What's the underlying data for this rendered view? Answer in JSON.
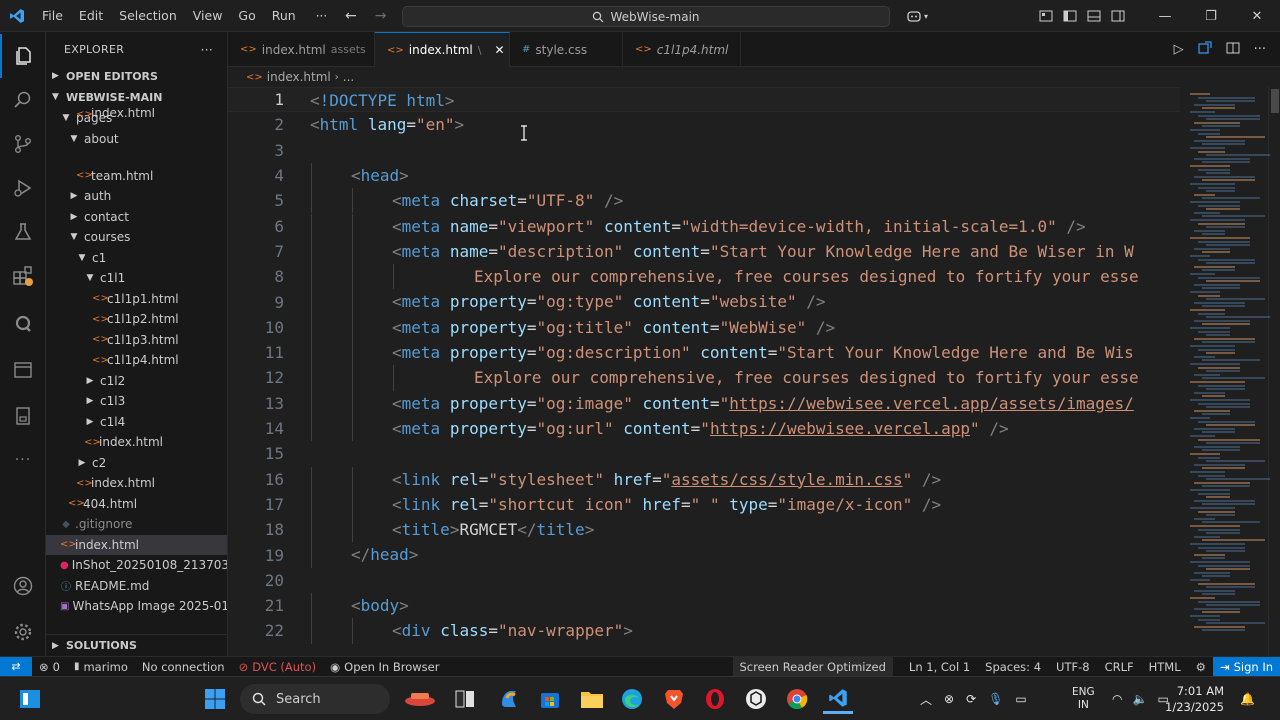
{
  "menu": [
    "File",
    "Edit",
    "Selection",
    "View",
    "Go",
    "Run"
  ],
  "menu_more": "···",
  "command_center": "WebWise-main",
  "explorer": {
    "header": "EXPLORER",
    "more": "···",
    "open_editors": "OPEN EDITORS",
    "root": "WEBWISE-MAIN",
    "solutions": "SOLUTIONS",
    "tree": [
      {
        "label": "pages",
        "depth": 1,
        "kind": "folder-open"
      },
      {
        "label": "about",
        "depth": 2,
        "kind": "folder-open"
      },
      {
        "label": "index.html",
        "depth": 3,
        "kind": "file",
        "partial": true
      },
      {
        "label": "team.html",
        "depth": 3,
        "kind": "file"
      },
      {
        "label": "auth",
        "depth": 2,
        "kind": "folder"
      },
      {
        "label": "contact",
        "depth": 2,
        "kind": "folder"
      },
      {
        "label": "courses",
        "depth": 2,
        "kind": "folder-open"
      },
      {
        "label": "c1",
        "depth": 3,
        "kind": "folder-open"
      },
      {
        "label": "c1l1",
        "depth": 4,
        "kind": "folder-open"
      },
      {
        "label": "c1l1p1.html",
        "depth": 5,
        "kind": "file"
      },
      {
        "label": "c1l1p2.html",
        "depth": 5,
        "kind": "file"
      },
      {
        "label": "c1l1p3.html",
        "depth": 5,
        "kind": "file"
      },
      {
        "label": "c1l1p4.html",
        "depth": 5,
        "kind": "file"
      },
      {
        "label": "c1l2",
        "depth": 4,
        "kind": "folder"
      },
      {
        "label": "c1l3",
        "depth": 4,
        "kind": "folder"
      },
      {
        "label": "c1l4",
        "depth": 4,
        "kind": "folder"
      },
      {
        "label": "index.html",
        "depth": 4,
        "kind": "file"
      },
      {
        "label": "c2",
        "depth": 3,
        "kind": "folder"
      },
      {
        "label": "index.html",
        "depth": 3,
        "kind": "file"
      },
      {
        "label": "404.html",
        "depth": 2,
        "kind": "file"
      },
      {
        "label": ".gitignore",
        "depth": 1,
        "kind": "git"
      },
      {
        "label": "index.html",
        "depth": 1,
        "kind": "file",
        "selected": true
      },
      {
        "label": "InShot_20250108_213703...",
        "depth": 1,
        "kind": "video"
      },
      {
        "label": "README.md",
        "depth": 1,
        "kind": "md"
      },
      {
        "label": "WhatsApp Image 2025-01...",
        "depth": 1,
        "kind": "image"
      }
    ]
  },
  "tabs": [
    {
      "label": "index.html",
      "desc": "assets",
      "active": false,
      "kind": "html"
    },
    {
      "label": "index.html",
      "desc": "\\",
      "active": true,
      "kind": "html"
    },
    {
      "label": "style.css",
      "desc": "",
      "active": false,
      "kind": "css"
    },
    {
      "label": "c1l1p4.html",
      "desc": "",
      "active": false,
      "kind": "html",
      "italic": true
    }
  ],
  "breadcrumbs": {
    "file": "index.html",
    "more": "..."
  },
  "code_lines": [
    {
      "n": "1",
      "indent": 0,
      "tokens": [
        [
          "punc",
          "<"
        ],
        [
          "tag",
          "!DOCTYPE"
        ],
        [
          "text",
          " "
        ],
        [
          "tag",
          "html"
        ],
        [
          "punc",
          ">"
        ]
      ]
    },
    {
      "n": "2",
      "indent": 0,
      "tokens": [
        [
          "punc",
          "<"
        ],
        [
          "tag",
          "html"
        ],
        [
          "text",
          " "
        ],
        [
          "attr",
          "lang"
        ],
        [
          "text",
          "="
        ],
        [
          "str",
          "\"en\""
        ],
        [
          "punc",
          ">"
        ]
      ]
    },
    {
      "n": "3",
      "indent": 0,
      "tokens": []
    },
    {
      "n": "4",
      "indent": 1,
      "tokens": [
        [
          "punc",
          "<"
        ],
        [
          "tag",
          "head"
        ],
        [
          "punc",
          ">"
        ]
      ]
    },
    {
      "n": "5",
      "indent": 2,
      "tokens": [
        [
          "punc",
          "<"
        ],
        [
          "tag",
          "meta"
        ],
        [
          "text",
          " "
        ],
        [
          "attr",
          "charset"
        ],
        [
          "text",
          "="
        ],
        [
          "str",
          "\"UTF-8\""
        ],
        [
          "text",
          " "
        ],
        [
          "punc",
          "/>"
        ]
      ]
    },
    {
      "n": "6",
      "indent": 2,
      "tokens": [
        [
          "punc",
          "<"
        ],
        [
          "tag",
          "meta"
        ],
        [
          "text",
          " "
        ],
        [
          "attr",
          "name"
        ],
        [
          "text",
          "="
        ],
        [
          "str",
          "\"viewport\""
        ],
        [
          "text",
          " "
        ],
        [
          "attr",
          "content"
        ],
        [
          "text",
          "="
        ],
        [
          "str",
          "\"width=device-width, initial-scale=1.0\""
        ],
        [
          "text",
          " "
        ],
        [
          "punc",
          "/>"
        ]
      ]
    },
    {
      "n": "7",
      "indent": 2,
      "tokens": [
        [
          "punc",
          "<"
        ],
        [
          "tag",
          "meta"
        ],
        [
          "text",
          " "
        ],
        [
          "attr",
          "name"
        ],
        [
          "text",
          "="
        ],
        [
          "str",
          "\"description\""
        ],
        [
          "text",
          " "
        ],
        [
          "attr",
          "content"
        ],
        [
          "text",
          "="
        ],
        [
          "str",
          "\"Start Your Knowledge Here and Be Wiser in W"
        ]
      ]
    },
    {
      "n": "8",
      "indent": 4,
      "tokens": [
        [
          "str",
          "Explore our comprehensive, free courses designed to fortify your esse"
        ]
      ]
    },
    {
      "n": "9",
      "indent": 2,
      "tokens": [
        [
          "punc",
          "<"
        ],
        [
          "tag",
          "meta"
        ],
        [
          "text",
          " "
        ],
        [
          "attr",
          "property"
        ],
        [
          "text",
          "="
        ],
        [
          "str",
          "\"og:type\""
        ],
        [
          "text",
          " "
        ],
        [
          "attr",
          "content"
        ],
        [
          "text",
          "="
        ],
        [
          "str",
          "\"website\""
        ],
        [
          "text",
          " "
        ],
        [
          "punc",
          "/>"
        ]
      ]
    },
    {
      "n": "10",
      "indent": 2,
      "tokens": [
        [
          "punc",
          "<"
        ],
        [
          "tag",
          "meta"
        ],
        [
          "text",
          " "
        ],
        [
          "attr",
          "property"
        ],
        [
          "text",
          "="
        ],
        [
          "str",
          "\"og:title\""
        ],
        [
          "text",
          " "
        ],
        [
          "attr",
          "content"
        ],
        [
          "text",
          "="
        ],
        [
          "str",
          "\"WebWise\""
        ],
        [
          "text",
          " "
        ],
        [
          "punc",
          "/>"
        ]
      ]
    },
    {
      "n": "11",
      "indent": 2,
      "tokens": [
        [
          "punc",
          "<"
        ],
        [
          "tag",
          "meta"
        ],
        [
          "text",
          " "
        ],
        [
          "attr",
          "property"
        ],
        [
          "text",
          "="
        ],
        [
          "str",
          "\"og:description\""
        ],
        [
          "text",
          " "
        ],
        [
          "attr",
          "content"
        ],
        [
          "text",
          "="
        ],
        [
          "str",
          "\"Start Your Knowledge Here and Be Wis"
        ]
      ]
    },
    {
      "n": "12",
      "indent": 4,
      "tokens": [
        [
          "str",
          "Explore our comprehensive, free courses designed to fortify your esse"
        ]
      ]
    },
    {
      "n": "13",
      "indent": 2,
      "tokens": [
        [
          "punc",
          "<"
        ],
        [
          "tag",
          "meta"
        ],
        [
          "text",
          " "
        ],
        [
          "attr",
          "property"
        ],
        [
          "text",
          "="
        ],
        [
          "str",
          "\"og:image\""
        ],
        [
          "text",
          " "
        ],
        [
          "attr",
          "content"
        ],
        [
          "text",
          "="
        ],
        [
          "str",
          "\""
        ],
        [
          "link",
          "https://webwisee.vercel.app/assets/images/"
        ]
      ]
    },
    {
      "n": "14",
      "indent": 2,
      "tokens": [
        [
          "punc",
          "<"
        ],
        [
          "tag",
          "meta"
        ],
        [
          "text",
          " "
        ],
        [
          "attr",
          "property"
        ],
        [
          "text",
          "="
        ],
        [
          "str",
          "\"og:url\""
        ],
        [
          "text",
          " "
        ],
        [
          "attr",
          "content"
        ],
        [
          "text",
          "="
        ],
        [
          "str",
          "\""
        ],
        [
          "link",
          "https://webwisee.vercel.app"
        ],
        [
          "str",
          "\""
        ],
        [
          "text",
          " "
        ],
        [
          "punc",
          "/>"
        ]
      ]
    },
    {
      "n": "15",
      "indent": 0,
      "tokens": []
    },
    {
      "n": "16",
      "indent": 2,
      "tokens": [
        [
          "punc",
          "<"
        ],
        [
          "tag",
          "link"
        ],
        [
          "text",
          " "
        ],
        [
          "attr",
          "rel"
        ],
        [
          "text",
          "="
        ],
        [
          "str",
          "\"stylesheet\""
        ],
        [
          "text",
          " "
        ],
        [
          "attr",
          "href"
        ],
        [
          "text",
          "="
        ],
        [
          "str",
          "\""
        ],
        [
          "link",
          "assets/css/style.min.css"
        ],
        [
          "str",
          "\""
        ],
        [
          "text",
          " "
        ],
        [
          "punc",
          "/>"
        ]
      ]
    },
    {
      "n": "17",
      "indent": 2,
      "tokens": [
        [
          "punc",
          "<"
        ],
        [
          "tag",
          "link"
        ],
        [
          "text",
          " "
        ],
        [
          "attr",
          "rel"
        ],
        [
          "text",
          "="
        ],
        [
          "str",
          "\"shortcut icon\""
        ],
        [
          "text",
          " "
        ],
        [
          "attr",
          "href"
        ],
        [
          "text",
          "="
        ],
        [
          "str",
          "\" \""
        ],
        [
          "text",
          " "
        ],
        [
          "attr",
          "type"
        ],
        [
          "text",
          "="
        ],
        [
          "str",
          "\"image/x-icon\""
        ],
        [
          "text",
          " "
        ],
        [
          "punc",
          "/>"
        ]
      ]
    },
    {
      "n": "18",
      "indent": 2,
      "tokens": [
        [
          "punc",
          "<"
        ],
        [
          "tag",
          "title"
        ],
        [
          "punc",
          ">"
        ],
        [
          "text",
          "RGMCET"
        ],
        [
          "punc",
          "</"
        ],
        [
          "tag",
          "title"
        ],
        [
          "punc",
          ">"
        ]
      ]
    },
    {
      "n": "19",
      "indent": 1,
      "tokens": [
        [
          "punc",
          "</"
        ],
        [
          "tag",
          "head"
        ],
        [
          "punc",
          ">"
        ]
      ]
    },
    {
      "n": "20",
      "indent": 0,
      "tokens": []
    },
    {
      "n": "21",
      "indent": 1,
      "tokens": [
        [
          "punc",
          "<"
        ],
        [
          "tag",
          "body"
        ],
        [
          "punc",
          ">"
        ]
      ]
    },
    {
      "n": "22",
      "indent": 2,
      "tokens": [
        [
          "punc",
          "<"
        ],
        [
          "tag",
          "div"
        ],
        [
          "text",
          " "
        ],
        [
          "attr",
          "class"
        ],
        [
          "text",
          "="
        ],
        [
          "str",
          "\"nav-wrapper\""
        ],
        [
          "punc",
          ">"
        ]
      ]
    }
  ],
  "status": {
    "errors": "0",
    "user": "marimo",
    "connection": "No connection",
    "dvc": "DVC (Auto)",
    "browser": "Open In Browser",
    "screen_reader": "Screen Reader Optimized",
    "position": "Ln 1, Col 1",
    "spaces": "Spaces: 4",
    "encoding": "UTF-8",
    "eol": "CRLF",
    "language": "HTML",
    "signin": "Sign In"
  },
  "taskbar": {
    "search": "Search",
    "lang_top": "ENG",
    "lang_bottom": "IN",
    "time": "7:01 AM",
    "date": "1/23/2025"
  }
}
